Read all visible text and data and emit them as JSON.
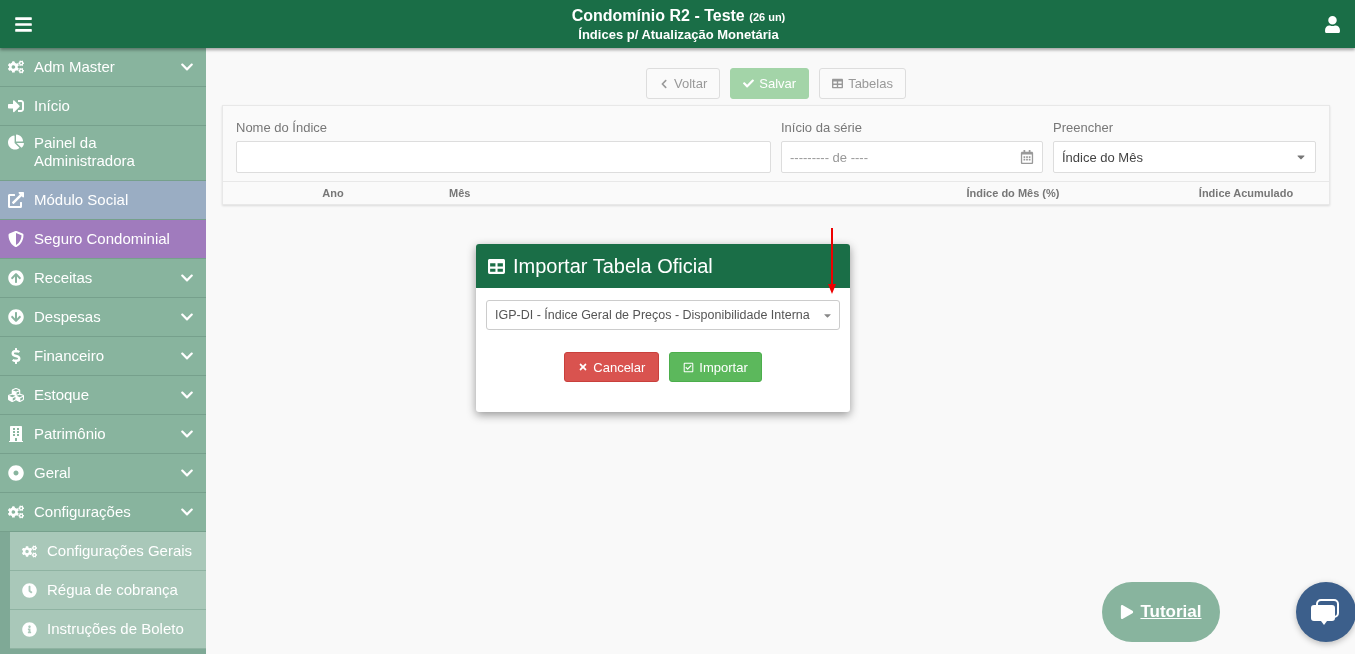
{
  "header": {
    "title": "Condomínio R2 - Teste",
    "units": "(26 un)",
    "subtitle": "Índices p/ Atualização Monetária"
  },
  "sidebar": {
    "items": [
      {
        "kind": "cogs",
        "label": "Adm Master",
        "expandable": true,
        "color": "#88b49e"
      },
      {
        "kind": "signin",
        "label": "Início",
        "expandable": false,
        "color": "#88b49e"
      },
      {
        "kind": "pie",
        "label": "Painel da Administradora",
        "expandable": false,
        "color": "#88b49e"
      },
      {
        "kind": "external",
        "label": "Módulo Social",
        "expandable": false,
        "color": "#9aadc3"
      },
      {
        "kind": "shield",
        "label": "Seguro Condominial",
        "expandable": false,
        "color": "#a07bbd"
      },
      {
        "kind": "up",
        "label": "Receitas",
        "expandable": true,
        "color": "#88b49e"
      },
      {
        "kind": "down",
        "label": "Despesas",
        "expandable": true,
        "color": "#88b49e"
      },
      {
        "kind": "dollar",
        "label": "Financeiro",
        "expandable": true,
        "color": "#88b49e"
      },
      {
        "kind": "cubes",
        "label": "Estoque",
        "expandable": true,
        "color": "#88b49e"
      },
      {
        "kind": "building",
        "label": "Patrimônio",
        "expandable": true,
        "color": "#88b49e"
      },
      {
        "kind": "dot",
        "label": "Geral",
        "expandable": true,
        "color": "#88b49e"
      },
      {
        "kind": "cogs",
        "label": "Configurações",
        "expandable": true,
        "color": "#88b49e",
        "children": [
          {
            "kind": "cogs",
            "label": "Configurações Gerais"
          },
          {
            "kind": "clock",
            "label": "Régua de cobrança"
          },
          {
            "kind": "info",
            "label": "Instruções de Boleto"
          }
        ]
      }
    ]
  },
  "toolbar": [
    {
      "kind": "back",
      "label": "Voltar"
    },
    {
      "kind": "save",
      "label": "Salvar"
    },
    {
      "kind": "table",
      "label": "Tabelas"
    }
  ],
  "form": {
    "name": {
      "label": "Nome do Índice"
    },
    "start": {
      "label": "Início da série",
      "placeholder": "--------- de ----"
    },
    "fill": {
      "label": "Preencher",
      "value": "Índice do Mês"
    }
  },
  "table": {
    "columns": [
      "Ano",
      "Mês",
      "Índice do Mês (%)",
      "Índice Acumulado"
    ]
  },
  "modal": {
    "title": "Importar Tabela Oficial",
    "select": "IGP-DI - Índice Geral de Preços - Disponibilidade Interna",
    "buttons": [
      {
        "kind": "cancel",
        "label": "Cancelar"
      },
      {
        "kind": "import",
        "label": "Importar"
      }
    ]
  },
  "tutorial": {
    "label": "Tutorial"
  }
}
